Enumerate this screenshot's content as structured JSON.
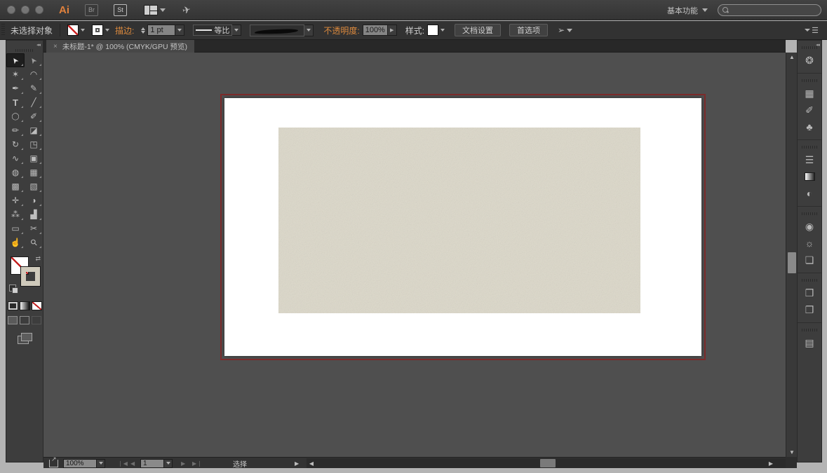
{
  "titlebar": {
    "app_logo": "Ai",
    "bridge_icon_label": "Br",
    "stock_icon_label": "St",
    "workspace_label": "基本功能",
    "search": {
      "value": "",
      "placeholder": ""
    }
  },
  "controlbar": {
    "selection_status": "未选择对象",
    "stroke_label": "描边:",
    "stroke_width_value": "1 pt",
    "width_profile_label": "等比",
    "opacity_label": "不透明度:",
    "opacity_value": "100%",
    "style_label": "样式:",
    "document_setup_button": "文档设置",
    "preferences_button": "首选项"
  },
  "document_tab": {
    "close_glyph": "×",
    "title": "未标题-1* @ 100% (CMYK/GPU 预览)"
  },
  "toolbar": {
    "collapse_glyph": "◂◂",
    "tools": [
      {
        "name": "selection-tool",
        "glyph": "➤"
      },
      {
        "name": "direct-selection-tool",
        "glyph": "➤"
      },
      {
        "name": "magic-wand-tool",
        "glyph": "✶"
      },
      {
        "name": "lasso-tool",
        "glyph": "◠"
      },
      {
        "name": "pen-tool",
        "glyph": "✒"
      },
      {
        "name": "curvature-tool",
        "glyph": "✎"
      },
      {
        "name": "type-tool",
        "glyph": "T"
      },
      {
        "name": "line-segment-tool",
        "glyph": "╱"
      },
      {
        "name": "rectangle-tool",
        "glyph": "◯"
      },
      {
        "name": "paintbrush-tool",
        "glyph": "✐"
      },
      {
        "name": "shaper-tool",
        "glyph": "✏"
      },
      {
        "name": "eraser-tool",
        "glyph": "◪"
      },
      {
        "name": "rotate-tool",
        "glyph": "↻"
      },
      {
        "name": "scale-tool",
        "glyph": "◳"
      },
      {
        "name": "width-tool",
        "glyph": "∿"
      },
      {
        "name": "free-transform-tool",
        "glyph": "▣"
      },
      {
        "name": "shape-builder-tool",
        "glyph": "◍"
      },
      {
        "name": "perspective-grid-tool",
        "glyph": "▦"
      },
      {
        "name": "mesh-tool",
        "glyph": "▩"
      },
      {
        "name": "gradient-tool",
        "glyph": "▧"
      },
      {
        "name": "eyedropper-tool",
        "glyph": "✛"
      },
      {
        "name": "blend-tool",
        "glyph": "◑"
      },
      {
        "name": "symbol-sprayer-tool",
        "glyph": "⁂"
      },
      {
        "name": "column-graph-tool",
        "glyph": "▟"
      },
      {
        "name": "artboard-tool",
        "glyph": "▭"
      },
      {
        "name": "slice-tool",
        "glyph": "✂"
      },
      {
        "name": "hand-tool",
        "glyph": "☝"
      },
      {
        "name": "zoom-tool",
        "glyph": "⚲"
      }
    ]
  },
  "dock": {
    "collapse_glyph": "◂◂",
    "icons": [
      {
        "name": "color-panel",
        "glyph": "❂"
      },
      {
        "name": "swatches-panel",
        "glyph": "▦"
      },
      {
        "name": "brushes-panel",
        "glyph": "✐"
      },
      {
        "name": "symbols-panel",
        "glyph": "♣"
      },
      {
        "name": "stroke-panel",
        "glyph": "☰"
      },
      {
        "name": "gradient-panel",
        "glyph": ""
      },
      {
        "name": "transparency-panel",
        "glyph": "◐"
      },
      {
        "name": "libraries-panel",
        "glyph": "◉"
      },
      {
        "name": "appearance-panel",
        "glyph": "☼"
      },
      {
        "name": "graphic-styles-panel",
        "glyph": "❏"
      },
      {
        "name": "layers-panel",
        "glyph": "❒"
      },
      {
        "name": "artboards-panel",
        "glyph": "❐"
      },
      {
        "name": "asset-export-panel",
        "glyph": "▤"
      }
    ]
  },
  "statusbar": {
    "zoom_value": "100%",
    "artboard_number": "1",
    "tool_status": "选择"
  },
  "canvas": {
    "background": "#4f4f4f",
    "artboard_color": "#ffffff",
    "bleed_line_color": "#7c2b2b",
    "placed_object_color": "#dcd8c9"
  }
}
